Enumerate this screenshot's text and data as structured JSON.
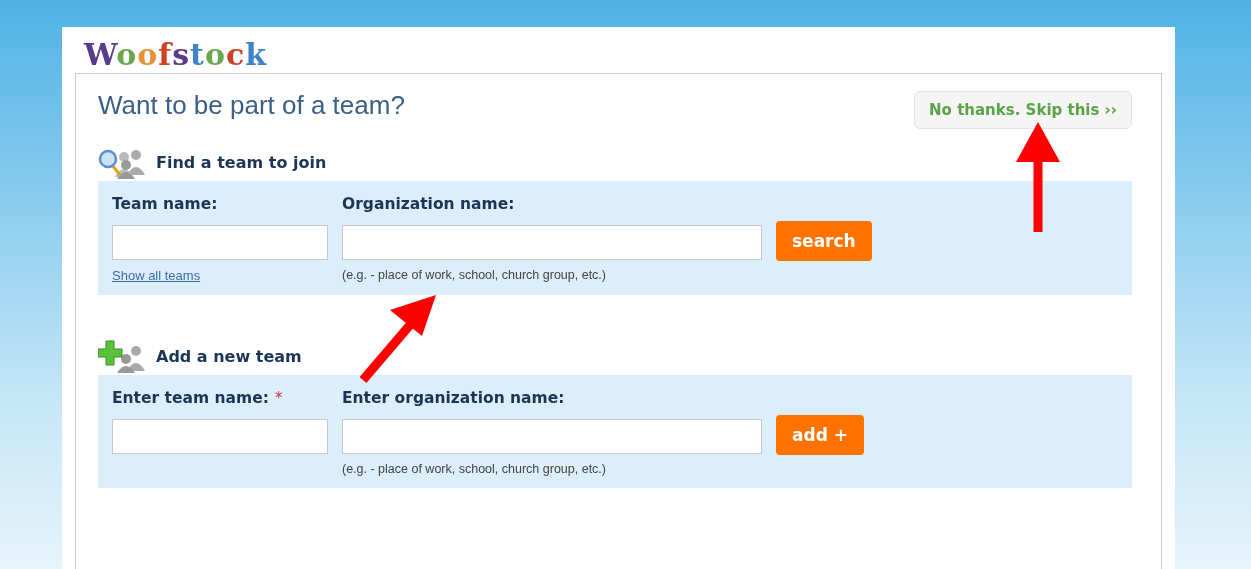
{
  "logo": "Woofstock",
  "heading": "Want to be part of a team?",
  "skip_button": "No thanks. Skip this ››",
  "sections": [
    {
      "kind": "find",
      "title": "Find a team to join",
      "team_label": "Team name:",
      "org_label": "Organization name:",
      "button": "search",
      "link": "Show all teams",
      "hint": "(e.g. - place of work, school, church group, etc.)"
    },
    {
      "kind": "add",
      "title": "Add a new team",
      "team_label": "Enter team name:",
      "required_mark": "*",
      "org_label": "Enter organization name:",
      "button": "add +",
      "hint": "(e.g. - place of work, school, church group, etc.)"
    }
  ]
}
